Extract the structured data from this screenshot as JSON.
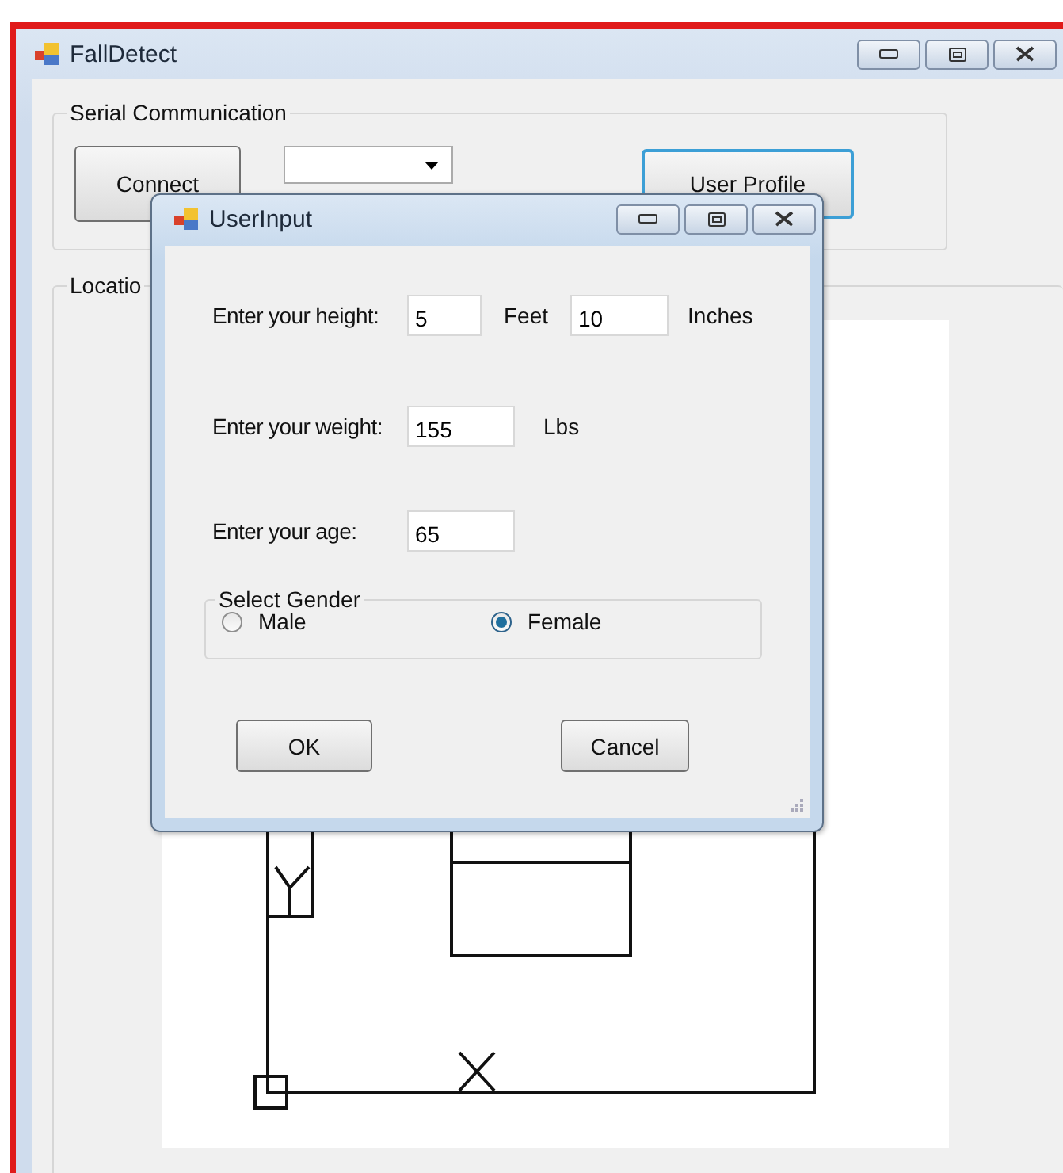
{
  "window": {
    "title": "FallDetect"
  },
  "serial_group": {
    "title": "Serial Communication",
    "connect_button": "Connect",
    "user_profile_button": "User Profile"
  },
  "location_group": {
    "title": "Locatio"
  },
  "dialog": {
    "title": "UserInput",
    "height_label": "Enter your height:",
    "feet_value": "5",
    "feet_unit": "Feet",
    "inches_value": "10",
    "inches_unit": "Inches",
    "weight_label": "Enter your weight:",
    "weight_value": "155",
    "weight_unit": "Lbs",
    "age_label": "Enter your age:",
    "age_value": "65",
    "gender_group": {
      "title": "Select Gender",
      "options": [
        {
          "label": "Male",
          "selected": false
        },
        {
          "label": "Female",
          "selected": true
        }
      ]
    },
    "buttons": [
      "OK",
      "Cancel"
    ]
  }
}
